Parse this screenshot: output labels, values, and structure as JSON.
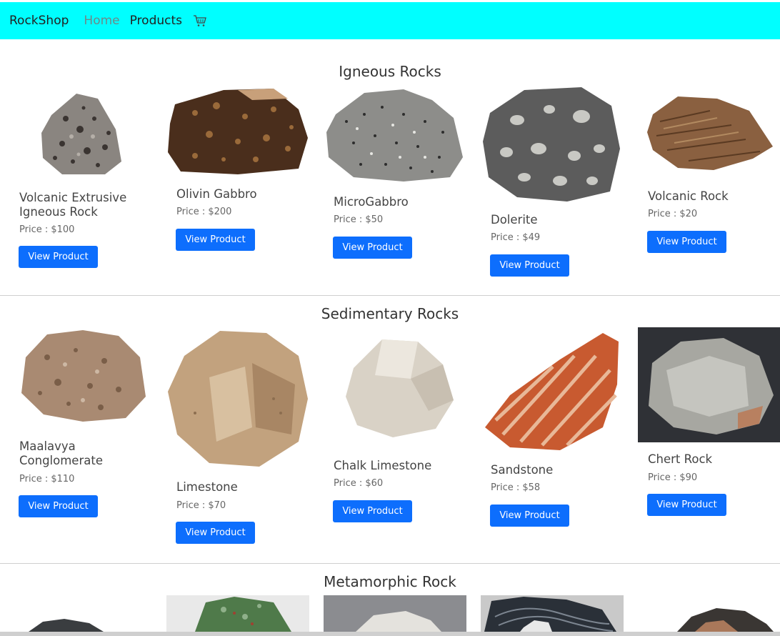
{
  "nav": {
    "brand": "RockShop",
    "home": "Home",
    "products": "Products",
    "cart_icon": "cart-icon"
  },
  "sections": [
    {
      "title": "Igneous Rocks",
      "products": [
        {
          "name": "Volcanic Extrusive Igneous Rock",
          "price": "Price : $100",
          "button": "View Product"
        },
        {
          "name": "Olivin Gabbro",
          "price": "Price : $200",
          "button": "View Product"
        },
        {
          "name": "MicroGabbro",
          "price": "Price : $50",
          "button": "View Product"
        },
        {
          "name": "Dolerite",
          "price": "Price : $49",
          "button": "View Product"
        },
        {
          "name": "Volcanic Rock",
          "price": "Price : $20",
          "button": "View Product"
        }
      ]
    },
    {
      "title": "Sedimentary Rocks",
      "products": [
        {
          "name": "Maalavya Conglomerate",
          "price": "Price : $110",
          "button": "View Product"
        },
        {
          "name": "Limestone",
          "price": "Price : $70",
          "button": "View Product"
        },
        {
          "name": "Chalk Limestone",
          "price": "Price : $60",
          "button": "View Product"
        },
        {
          "name": "Sandstone",
          "price": "Price : $58",
          "button": "View Product"
        },
        {
          "name": "Chert Rock",
          "price": "Price : $90",
          "button": "View Product"
        }
      ]
    },
    {
      "title": "Metamorphic Rock"
    }
  ],
  "colors": {
    "navbar": "#00ffff",
    "button": "#0d6efd"
  }
}
